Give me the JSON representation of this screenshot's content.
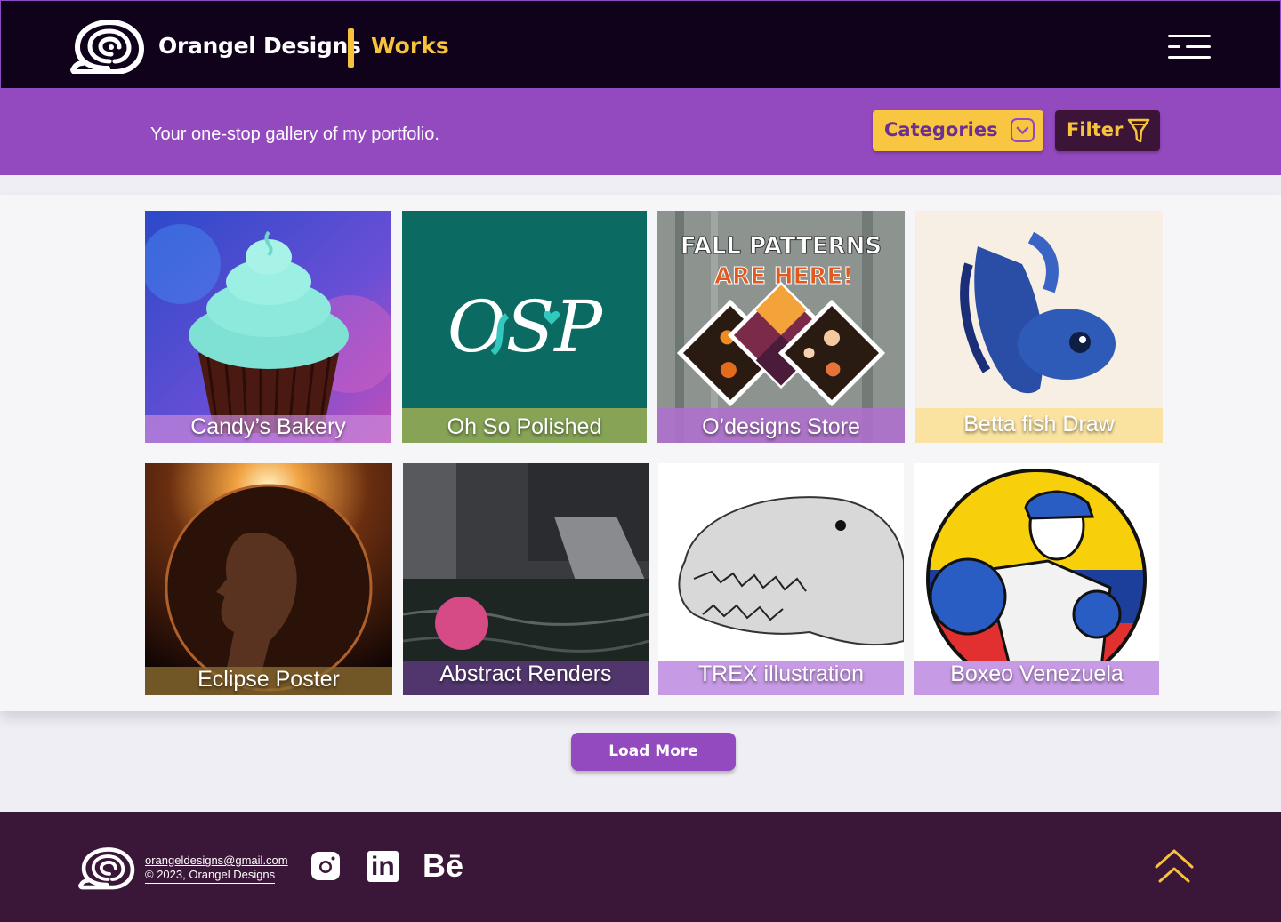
{
  "header": {
    "brand": "Orangel Designs",
    "section": "Works",
    "accent_color": "#f7c33a",
    "logo_icon": "snail-spiral-logo-icon",
    "menu_icon": "hamburger-menu-icon"
  },
  "subheader": {
    "tagline": "Your one-stop gallery of my portfolio.",
    "categories_label": "Categories",
    "filter_label": "Filter"
  },
  "gallery": {
    "items": [
      {
        "title": "Candy’s Bakery"
      },
      {
        "title": "Oh So Polished",
        "logo_text": "OSP"
      },
      {
        "title": "O’designs Store",
        "banner_line1": "FALL PATTERNS",
        "banner_line2": "ARE HERE!"
      },
      {
        "title": "Betta fish Draw"
      },
      {
        "title": "Eclipse Poster"
      },
      {
        "title": "Abstract Renders"
      },
      {
        "title": "TREX illustration"
      },
      {
        "title": "Boxeo Venezuela"
      }
    ]
  },
  "load_more_label": "Load More",
  "footer": {
    "email": "orangeldesigns@gmail.com",
    "copyright": "© 2023, Orangel Designs",
    "social": [
      "instagram-icon",
      "linkedin-icon",
      "behance-icon"
    ],
    "behance_text": "Bē",
    "linkedin_text": "in",
    "back_to_top_icon": "double-chevron-up-icon"
  },
  "colors": {
    "header_bg": "#10021a",
    "purple": "#944abf",
    "yellow": "#f8c640",
    "footer_bg": "#3a1638"
  }
}
